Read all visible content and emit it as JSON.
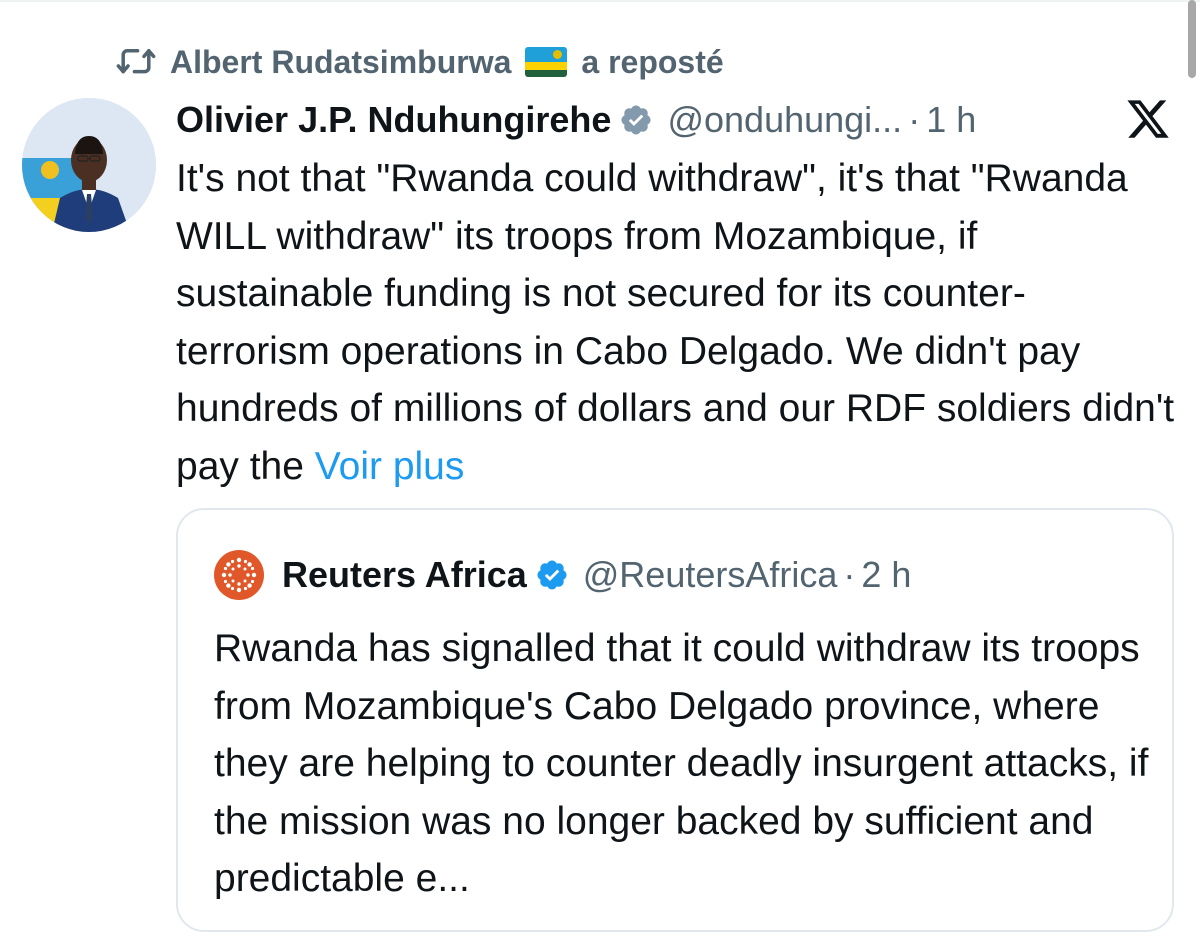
{
  "repost": {
    "icon": "repost-icon",
    "name": "Albert Rudatsimburwa",
    "flag": "rwanda-flag",
    "suffix": "a reposté"
  },
  "tweet": {
    "author_name": "Olivier J.P. Nduhungirehe",
    "verified": true,
    "handle": "@onduhungi...",
    "separator": "·",
    "time": "1 h",
    "platform_icon": "x-logo-icon",
    "text": "It's not that \"Rwanda could withdraw\", it's that \"Rwanda WILL withdraw\" its troops from Mozambique, if sustainable funding is not secured for its counter-terrorism operations in Cabo Delgado. We didn't pay hundreds of millions of dollars and our RDF soldiers didn't pay the",
    "more_link": "Voir plus"
  },
  "quote": {
    "author_name": "Reuters Africa",
    "verified": true,
    "handle": "@ReutersAfrica",
    "separator": "·",
    "time": "2 h",
    "text": "Rwanda has signalled that it could withdraw its troops from Mozambique's Cabo Delgado province, where they are helping to counter deadly insurgent attacks, if the mission was no longer backed by sufficient and predictable e..."
  },
  "colors": {
    "text": "#0f1419",
    "secondary": "#536471",
    "link": "#1d9bf0",
    "verified": "#1d9bf0",
    "reuters_orange": "#e0582a",
    "border": "#e1e8ed"
  }
}
